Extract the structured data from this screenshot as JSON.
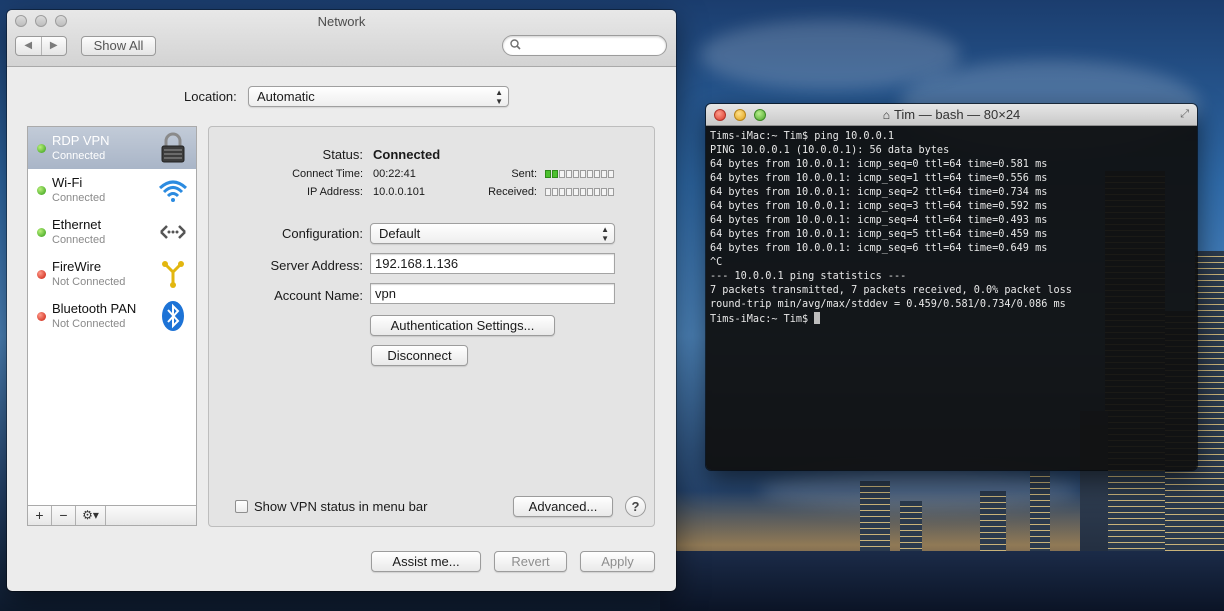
{
  "network_window": {
    "title": "Network",
    "toolbar": {
      "back_glyph": "◀",
      "forward_glyph": "▶",
      "show_all": "Show All",
      "search_placeholder": ""
    },
    "location": {
      "label": "Location:",
      "value": "Automatic"
    },
    "services": [
      {
        "name": "RDP VPN",
        "status": "Connected",
        "indicator": "#3aa81f",
        "icon": "lock-icon",
        "selected": true
      },
      {
        "name": "Wi-Fi",
        "status": "Connected",
        "indicator": "#3aa81f",
        "icon": "wifi-icon",
        "selected": false
      },
      {
        "name": "Ethernet",
        "status": "Connected",
        "indicator": "#3aa81f",
        "icon": "ethernet-icon",
        "selected": false
      },
      {
        "name": "FireWire",
        "status": "Not Connected",
        "indicator": "#d0281a",
        "icon": "firewire-icon",
        "selected": false
      },
      {
        "name": "Bluetooth PAN",
        "status": "Not Connected",
        "indicator": "#d0281a",
        "icon": "bluetooth-icon",
        "selected": false
      }
    ],
    "sidebar_buttons": {
      "add": "+",
      "remove": "−",
      "action": "⚙▾"
    },
    "detail": {
      "status_label": "Status:",
      "status_value": "Connected",
      "connect_time_label": "Connect Time:",
      "connect_time_value": "00:22:41",
      "ip_label": "IP Address:",
      "ip_value": "10.0.0.101",
      "sent_label": "Sent:",
      "received_label": "Received:",
      "sent_level": 0.2,
      "received_level": 0.0,
      "configuration_label": "Configuration:",
      "configuration_value": "Default",
      "server_address_label": "Server Address:",
      "server_address_value": "192.168.1.136",
      "account_name_label": "Account Name:",
      "account_name_value": "vpn",
      "auth_settings_button": "Authentication Settings...",
      "disconnect_button": "Disconnect",
      "show_vpn_status_label": "Show VPN status in menu bar",
      "show_vpn_status_checked": false,
      "advanced_button": "Advanced...",
      "help_button": "?"
    },
    "footer": {
      "assist_button": "Assist me...",
      "revert_button": "Revert",
      "apply_button": "Apply"
    }
  },
  "terminal": {
    "title": "Tim — bash — 80×24",
    "lines": [
      "Tims-iMac:~ Tim$ ping 10.0.0.1",
      "PING 10.0.0.1 (10.0.0.1): 56 data bytes",
      "64 bytes from 10.0.0.1: icmp_seq=0 ttl=64 time=0.581 ms",
      "64 bytes from 10.0.0.1: icmp_seq=1 ttl=64 time=0.556 ms",
      "64 bytes from 10.0.0.1: icmp_seq=2 ttl=64 time=0.734 ms",
      "64 bytes from 10.0.0.1: icmp_seq=3 ttl=64 time=0.592 ms",
      "64 bytes from 10.0.0.1: icmp_seq=4 ttl=64 time=0.493 ms",
      "64 bytes from 10.0.0.1: icmp_seq=5 ttl=64 time=0.459 ms",
      "64 bytes from 10.0.0.1: icmp_seq=6 ttl=64 time=0.649 ms",
      "^C",
      "--- 10.0.0.1 ping statistics ---",
      "7 packets transmitted, 7 packets received, 0.0% packet loss",
      "round-trip min/avg/max/stddev = 0.459/0.581/0.734/0.086 ms"
    ],
    "prompt": "Tims-iMac:~ Tim$ "
  }
}
